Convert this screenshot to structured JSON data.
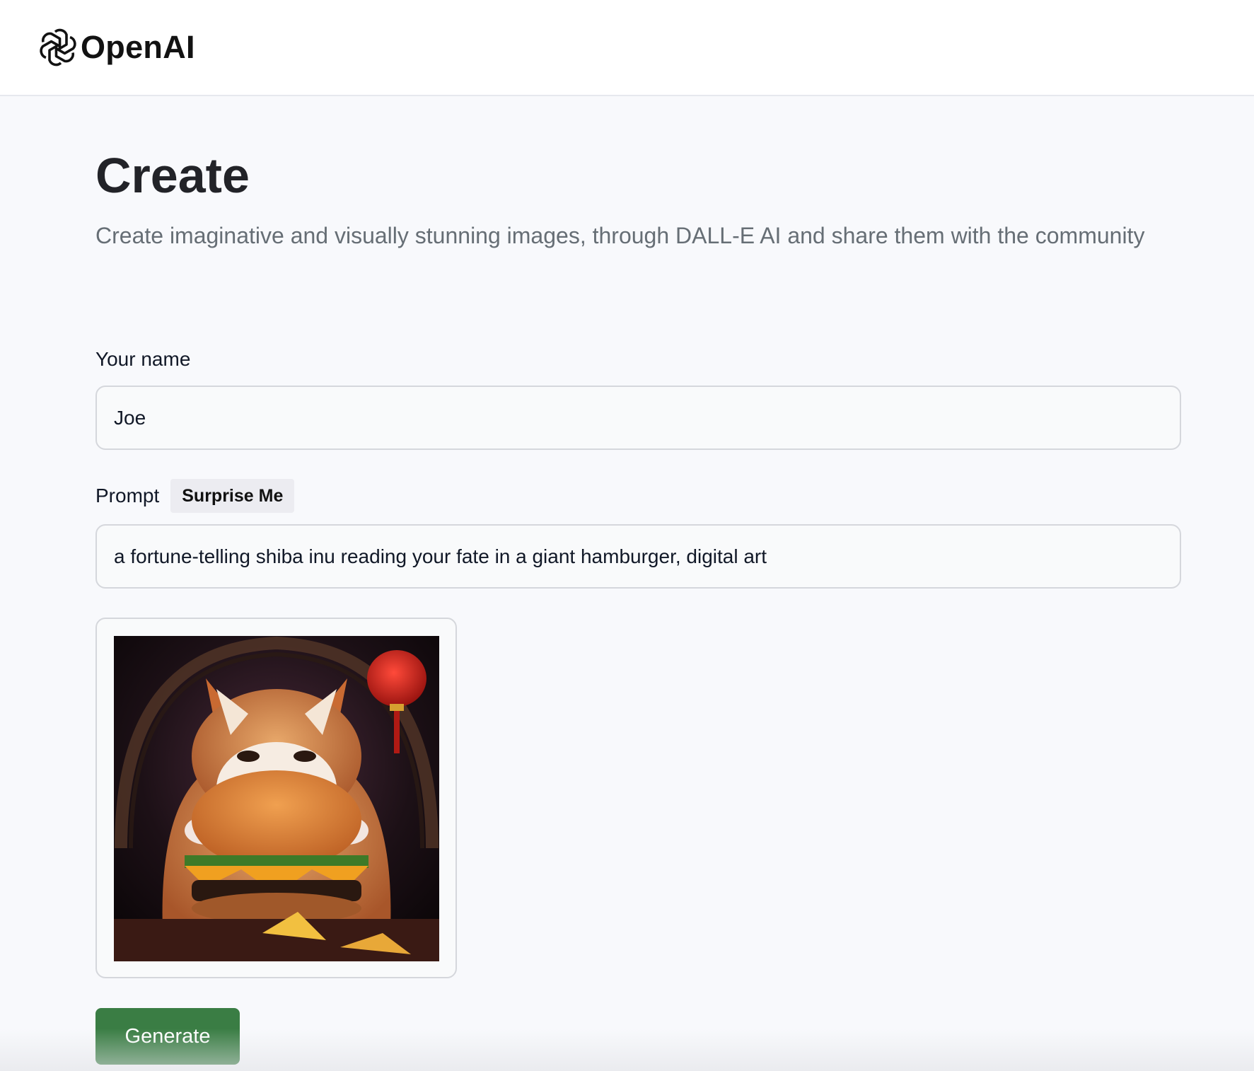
{
  "header": {
    "brand": "OpenAI",
    "logo_icon": "openai-logo-icon"
  },
  "page": {
    "title": "Create",
    "subtitle": "Create imaginative and visually stunning images, through DALL-E AI and share them with the community"
  },
  "form": {
    "name_label": "Your name",
    "name_value": "Joe",
    "prompt_label": "Prompt",
    "surprise_label": "Surprise Me",
    "prompt_value": "a fortune-telling shiba inu reading your fate in a giant hamburger, digital art",
    "generate_label": "Generate"
  },
  "colors": {
    "accent": "#3a7d44",
    "background": "#f8f9fc",
    "subtitle": "#666e75"
  }
}
